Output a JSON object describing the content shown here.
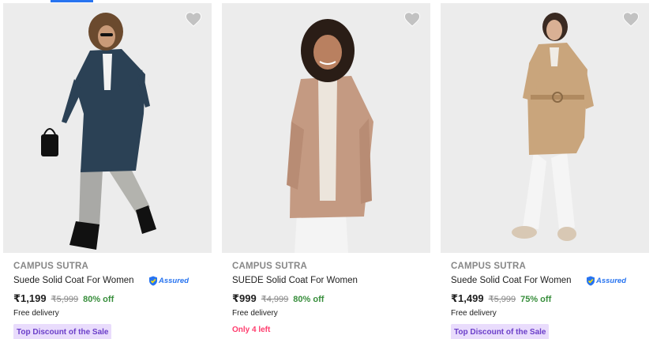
{
  "colors": {
    "accent": "#2874f0",
    "discount_green": "#388e3c",
    "tag_bg": "#e9dcfc",
    "tag_text": "#6b3fc9",
    "stock_red": "#ff3d6e"
  },
  "products": [
    {
      "brand": "CAMPUS SUTRA",
      "title": "Suede Solid Coat For Women",
      "assured": "Assured",
      "price": "₹1,199",
      "mrp": "₹5,999",
      "discount": "80% off",
      "delivery": "Free delivery",
      "tag": "Top Discount of the Sale",
      "coat_color": "#2b4155",
      "icon": "heart-icon"
    },
    {
      "brand": "CAMPUS SUTRA",
      "title": "SUEDE Solid Coat For Women",
      "price": "₹999",
      "mrp": "₹4,999",
      "discount": "80% off",
      "delivery": "Free delivery",
      "stock": "Only 4 left",
      "coat_color": "#c49a82",
      "icon": "heart-icon"
    },
    {
      "brand": "CAMPUS SUTRA",
      "title": "Suede Solid Coat For Women",
      "assured": "Assured",
      "price": "₹1,499",
      "mrp": "₹5,999",
      "discount": "75% off",
      "delivery": "Free delivery",
      "tag": "Top Discount of the Sale",
      "coat_color": "#c9a57c",
      "icon": "heart-icon"
    }
  ]
}
